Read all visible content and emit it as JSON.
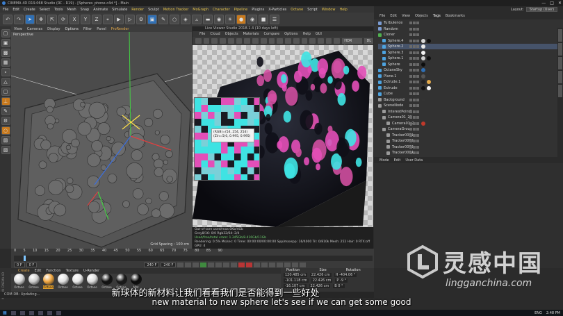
{
  "window": {
    "title": "CINEMA 4D R19.068 Studio (RC - R19) - [Spheres_phone.c4d *] - Main",
    "layout_label": "Layout:",
    "layout_value": "Startup (User)"
  },
  "menubar": [
    "File",
    "Edit",
    "Create",
    "Select",
    "Tools",
    "Mesh",
    "Snap",
    "Animate",
    "Simulate",
    "Render",
    "Sculpt",
    "Motion Tracker",
    "MoGraph",
    "Character",
    "Pipeline",
    "Plugins",
    "X-Particles",
    "Octane",
    "Script",
    "Window",
    "Help"
  ],
  "viewport": {
    "menu": [
      "View",
      "Cameras",
      "Display",
      "Options",
      "Filter",
      "Panel",
      "ProRender"
    ],
    "label": "Perspective",
    "grid_spacing": "Grid Spacing : 100 cm"
  },
  "live_viewer": {
    "title": "Live Viewer Studio 2018.1.4 (10 days left)",
    "menu": [
      "File",
      "Cloud",
      "Objects",
      "Materials",
      "Compare",
      "Options",
      "Help",
      "GUI"
    ],
    "mode": "HDR tone",
    "kernel": "DL",
    "pixel_tip": [
      "(RGB)=(54, 254, 254)",
      "(Zin=5(0, 0.995, 0.995)"
    ],
    "info": [
      "Out-of-core used/max:0Kb/4Gb",
      "Grey8/16: 0/0          Rgb32/64: 2/4",
      "Used/free/total vram: 1.345Gb/8.416Gb/11Gb",
      "Rendering: 0.5%   Ms/sec: 0   Time: 00:00:00/00:00:00   Spp/maxspp: 16/4000   Tri: 0/810k   Mesh: 252   Hair: 0   RTX:off   GPU: 4"
    ]
  },
  "objects": {
    "menu": [
      "File",
      "Edit",
      "View",
      "Objects",
      "Tags",
      "Bookmarks"
    ],
    "items": [
      {
        "name": "Turbulence",
        "indent": 0,
        "color": "#7a9bd1",
        "tags": []
      },
      {
        "name": "Random",
        "indent": 0,
        "color": "#7a9bd1",
        "tags": []
      },
      {
        "name": "Cloner",
        "indent": 0,
        "color": "#4fb04f",
        "tags": []
      },
      {
        "name": "Sphere.4",
        "indent": 1,
        "color": "#4da3e0",
        "tags": [
          "#d8d8d8",
          "#111111"
        ]
      },
      {
        "name": "Sphere.2",
        "indent": 1,
        "color": "#4da3e0",
        "tags": [
          "#e8e8e8"
        ]
      },
      {
        "name": "Sphere.3",
        "indent": 1,
        "color": "#4da3e0",
        "tags": [
          "#f4f4f4"
        ]
      },
      {
        "name": "Sphere.1",
        "indent": 1,
        "color": "#4da3e0",
        "tags": [
          "#d0d0d0",
          "#101010"
        ]
      },
      {
        "name": "Sphere",
        "indent": 1,
        "color": "#4da3e0",
        "tags": [
          "#0d0d0d"
        ]
      },
      {
        "name": "OctaneSky",
        "indent": 0,
        "color": "#4da3e0",
        "tags": [
          "#2f6fb4"
        ]
      },
      {
        "name": "Plane.1",
        "indent": 0,
        "color": "#4da3e0",
        "tags": [
          "#555555"
        ]
      },
      {
        "name": "Extrude.1",
        "indent": 0,
        "color": "#4da3e0",
        "tags": [
          "#222222",
          "#e3a94a"
        ]
      },
      {
        "name": "Extrude",
        "indent": 0,
        "color": "#4da3e0",
        "tags": [
          "#111111",
          "#f5f5f5"
        ]
      },
      {
        "name": "Cube",
        "indent": 0,
        "color": "#4da3e0",
        "tags": []
      },
      {
        "name": "Background",
        "indent": 0,
        "color": "#9a9a9a",
        "tags": [
          "#333333"
        ]
      },
      {
        "name": "SceneNode",
        "indent": 0,
        "color": "#9a9a9a",
        "tags": []
      },
      {
        "name": "InterestPoint0",
        "indent": 1,
        "color": "#9a9a9a",
        "tags": []
      },
      {
        "name": "Camera01_2H",
        "indent": 1,
        "color": "#9a9a9a",
        "tags": []
      },
      {
        "name": "Camera01_2",
        "indent": 2,
        "color": "#9a9a9a",
        "tags": [
          "#c0392b"
        ]
      },
      {
        "name": "CameraGroup",
        "indent": 1,
        "color": "#9a9a9a",
        "tags": []
      },
      {
        "name": "Tracker0001",
        "indent": 2,
        "color": "#9a9a9a",
        "tags": []
      },
      {
        "name": "Tracker0002",
        "indent": 2,
        "color": "#9a9a9a",
        "tags": []
      },
      {
        "name": "Tracker0003",
        "indent": 2,
        "color": "#9a9a9a",
        "tags": []
      },
      {
        "name": "Tracker0004",
        "indent": 2,
        "color": "#9a9a9a",
        "tags": []
      }
    ]
  },
  "attributes": {
    "menu": [
      "Mode",
      "Edit",
      "User Data"
    ]
  },
  "timeline": {
    "ticks": [
      "0",
      "5",
      "10",
      "15",
      "20",
      "25",
      "30",
      "35",
      "40",
      "45",
      "50",
      "55",
      "60",
      "65",
      "70",
      "75",
      "80",
      "85",
      "90"
    ],
    "current_frame": "0 F",
    "start_frame": "0 F",
    "end_frame": "240 F",
    "max_frame": "240 F"
  },
  "materials": {
    "menu": [
      "Create",
      "Edit",
      "Function",
      "Texture",
      "U-Render"
    ],
    "items": [
      {
        "label": "Octane",
        "color": "#d9d9d9"
      },
      {
        "label": "Octane",
        "color": "#cfcfcf"
      },
      {
        "label": "Octane",
        "color": "#f0a640",
        "selected": true
      },
      {
        "label": "Octane",
        "color": "#e0e0e0"
      },
      {
        "label": "Octane",
        "color": "#e6e6e6"
      },
      {
        "label": "Octane",
        "color": "#dcdcdc"
      },
      {
        "label": "Octane",
        "color": "#111111"
      },
      {
        "label": "Octane",
        "color": "#1a1a1a"
      },
      {
        "label": "Mat",
        "color": "#0a0a0a"
      }
    ]
  },
  "coordinates": {
    "headers": [
      "Position",
      "Size",
      "Rotation"
    ],
    "rows": [
      [
        "120.485 cm",
        "22.426 cm",
        "H -404.06 °"
      ],
      [
        "-101.118 cm",
        "22.426 cm",
        "P -9 °"
      ],
      [
        "-16.107 cm",
        "22.426 cm",
        "B 0 °"
      ]
    ]
  },
  "status": "COM DB: Updating...",
  "subtitles": {
    "zh": "新球体的新材料让我们看看我们是否能得到一些好处",
    "en": "new material to new sphere let's see if we can get some good"
  },
  "watermark": {
    "name": "灵感中国",
    "url": "lingganchina.com"
  },
  "tray": {
    "lang": "ENG",
    "time": "2:48 PM"
  },
  "colors": {
    "accent": "#e3a94a",
    "cyan": "#3fe3e3",
    "magenta": "#e34fb8"
  }
}
